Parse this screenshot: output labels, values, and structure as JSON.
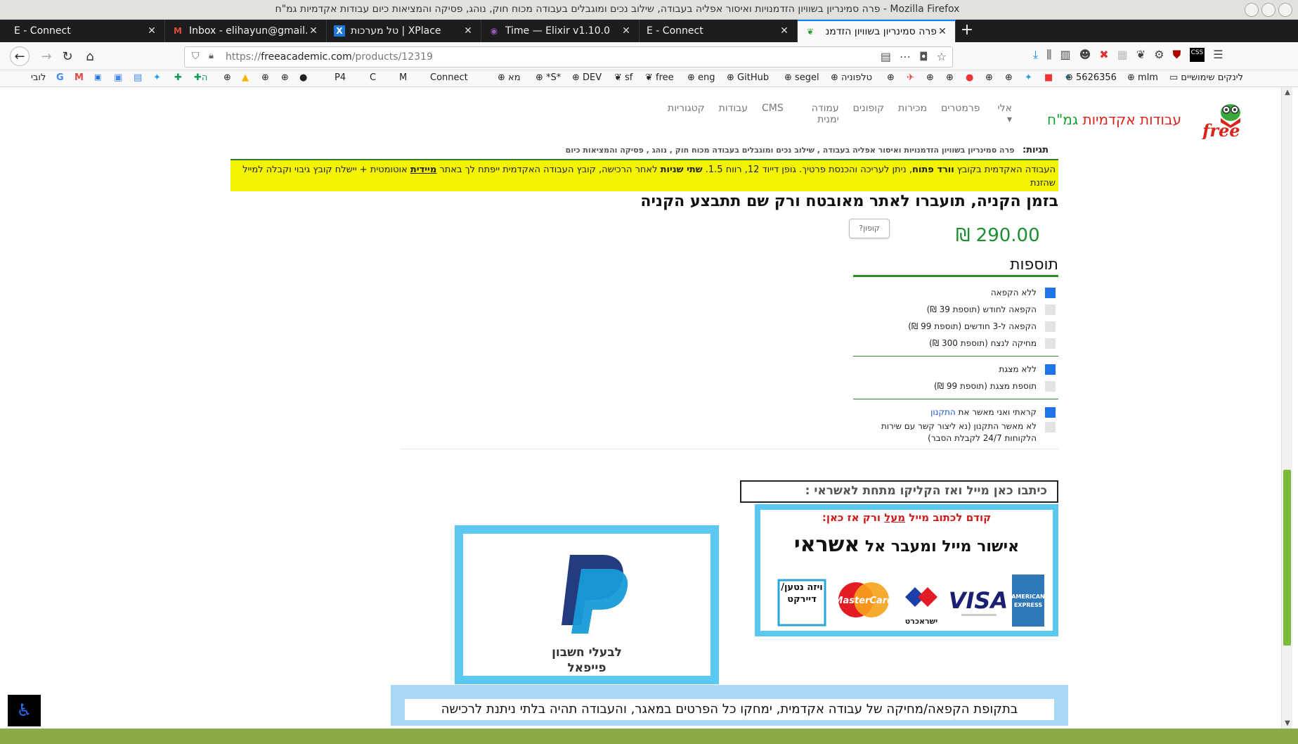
{
  "window": {
    "title": "פרה סמינריון בשוויון הזדמנויות ואיסור אפליה בעבודה, שילוב נכים ומוגבלים בעבודה מכוח חוק, נוהג, פסיקה והמציאות כיום עבודות אקדמיות גמ\"ח - Mozilla Firefox"
  },
  "tabs": [
    {
      "label": "E - Connect",
      "active": false
    },
    {
      "label": "Inbox - elihayun@gmail.c",
      "active": false
    },
    {
      "label": "טל מערכות | XPlace",
      "active": false
    },
    {
      "label": "Time — Elixir v1.10.0",
      "active": false
    },
    {
      "label": "E - Connect",
      "active": false
    },
    {
      "label": "פרה סמינריון בשוויון הזדמנ",
      "active": true
    }
  ],
  "navbar": {
    "url_prefix": "https://",
    "url_domain": "freeacademic.com",
    "url_path": "/products/12319"
  },
  "bookmarks": [
    "לובי",
    "P4",
    "C",
    "M",
    "Connect",
    "מא",
    "*S*",
    "DEV",
    "sf",
    "free",
    "eng",
    "GitHub",
    "segel",
    "טלפוניה",
    "5626356",
    "mlm",
    "לינקים שימושיים"
  ],
  "site": {
    "brand_red": "עבודות אקדמיות",
    "brand_green": "גמ\"ח",
    "logo_text": "free",
    "menu": [
      "קטגוריות",
      "עבודות",
      "CMS",
      "עמודה ימנית",
      "קופונים",
      "מכירות",
      "פרמטרים",
      "אלי ▾"
    ],
    "tags_label": "תגיות:",
    "tags": "פרה סמינריון בשוויון הזדמנויות ואיסור אפליה בעבודה ,  שילוב נכים ומוגבלים בעבודה מכוח חוק ,  נוהג ,  פסיקה והמציאות כיום"
  },
  "notice": {
    "part1": "העבודה האקדמית בקובץ ",
    "bold1": "וורד פתוח",
    "part2": ", ניתן לעריכה והכנסת פרטיך. גופן דייוד 12, רווח 1.5. ",
    "bold2": "שתי שניות",
    "part3": " לאחר הרכישה, קובץ העבודה האקדמית ייפתח לך באתר ",
    "bold3": "מיידית",
    "part4": " אוטומטית + יישלח קובץ גיבוי וקבלה למייל שהזנת"
  },
  "headline": "בזמן הקניה, תועברו לאתר מאובטח ורק שם תתבצע הקניה",
  "coupon_label": "קופון?",
  "price": "₪ 290.00",
  "addons": {
    "title": "תוספות",
    "group1": [
      {
        "label": "ללא הקפאה",
        "checked": true
      },
      {
        "label": "הקפאה לחודש (תוספת 39 ₪)",
        "checked": false
      },
      {
        "label": "הקפאה ל-3 חודשים (תוספת 99 ₪)",
        "checked": false
      },
      {
        "label": "מחיקה לנצח (תוספת 300 ₪)",
        "checked": false
      }
    ],
    "group2": [
      {
        "label": "ללא מצגת",
        "checked": true
      },
      {
        "label": "תוספת מצגת (תוספת 99 ₪)",
        "checked": false
      }
    ],
    "terms_accept_prefix": "קראתי ואני מאשר את ",
    "terms_link": "התקנון",
    "terms_decline": "לא מאשר התקנון (נא ליצור קשר עם שירות הלקוחות 24/7 לקבלת הסבר)"
  },
  "email_prompt": "כיתבו כאן מייל ואז הקליקו מתחת לאשראי :",
  "credit": {
    "warn_prefix": "קודם לכתוב מייל ",
    "warn_underlined": "מעל",
    "warn_suffix": " ורק אז כאן:",
    "main_prefix": "אישור מייל ומעבר אל ",
    "main_big": "אשראי",
    "visa_net": "ויזה נטען/ דיירקט",
    "isracard": "ישראכרט",
    "mastercard": "MasterCard",
    "visa": "VISA",
    "amex_1": "AMERICAN",
    "amex_2": "EXPRESS"
  },
  "paypal": {
    "line1": "לבעלי חשבון",
    "line2": "פייפאל"
  },
  "bottom_note": "בתקופת הקפאה/מחיקה של עבודה אקדמית, ימחקו כל הפרטים במאגר, והעבודה תהיה בלתי ניתנת לרכישה",
  "accessibility_icon": "♿",
  "colors": {
    "accent_blue": "#5ac8f0",
    "price_green": "#1a8f2f",
    "notice_yellow": "#f4f400",
    "brand_red": "#d9231b"
  }
}
